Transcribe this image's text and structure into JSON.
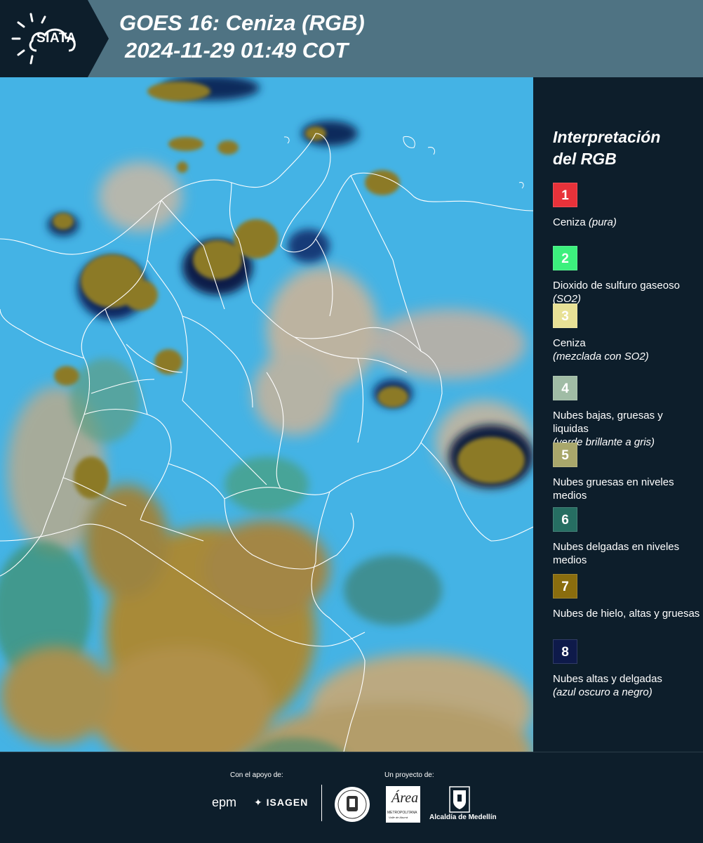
{
  "header": {
    "logo_text": "SIATA",
    "title_line1": "GOES 16: Ceniza (RGB)",
    "title_line2": "2024-11-29 01:49 COT",
    "background_color": "#4f7383",
    "logo_background_color": "#0d1e2b"
  },
  "map": {
    "colors": {
      "sky_background": "#44b3e5",
      "ice_clouds": "#8c7a28",
      "tan_clouds": "#d2b495",
      "thin_high_clouds": "#0b2a5c",
      "boundaries": "#ffffff"
    }
  },
  "legend": {
    "title_line1": "Interpretación",
    "title_line2": "del RGB",
    "items": [
      {
        "number": "1",
        "color": "#e8323a",
        "label": "Ceniza",
        "label_italic": "(pura)",
        "inline_italic": true
      },
      {
        "number": "2",
        "color": "#3cf07d",
        "label": "Dioxido de sulfuro gaseoso",
        "label_italic": "(SO2)",
        "inline_italic": true
      },
      {
        "number": "3",
        "color": "#e8e196",
        "label": "Ceniza",
        "label_italic": "(mezclada con SO2)",
        "inline_italic": false
      },
      {
        "number": "4",
        "color": "#a0bca5",
        "label": "Nubes bajas, gruesas y liquidas",
        "label_italic": "(verde brillante a gris)",
        "inline_italic": false
      },
      {
        "number": "5",
        "color": "#a9a76b",
        "label": "Nubes gruesas en niveles medios",
        "label_italic": "",
        "inline_italic": false
      },
      {
        "number": "6",
        "color": "#266e62",
        "label": "Nubes delgadas en niveles medios",
        "label_italic": "",
        "inline_italic": false
      },
      {
        "number": "7",
        "color": "#8a6d0e",
        "label": "Nubes de hielo, altas y gruesas",
        "label_italic": "",
        "inline_italic": false
      },
      {
        "number": "8",
        "color": "#0e1a4a",
        "label": "Nubes altas y delgadas",
        "label_italic": "(azul oscuro a negro)",
        "inline_italic": false
      }
    ]
  },
  "footer": {
    "support_caption": "Con el apoyo de:",
    "project_caption": "Un proyecto de:",
    "sponsor1": "epm",
    "sponsor2": "ISAGEN",
    "area_logo_word": "Área",
    "area_logo_sub": "METROPOLITANA",
    "area_logo_sub2": "Valle de Aburrá",
    "alcaldia": "Alcaldía de Medellín"
  }
}
